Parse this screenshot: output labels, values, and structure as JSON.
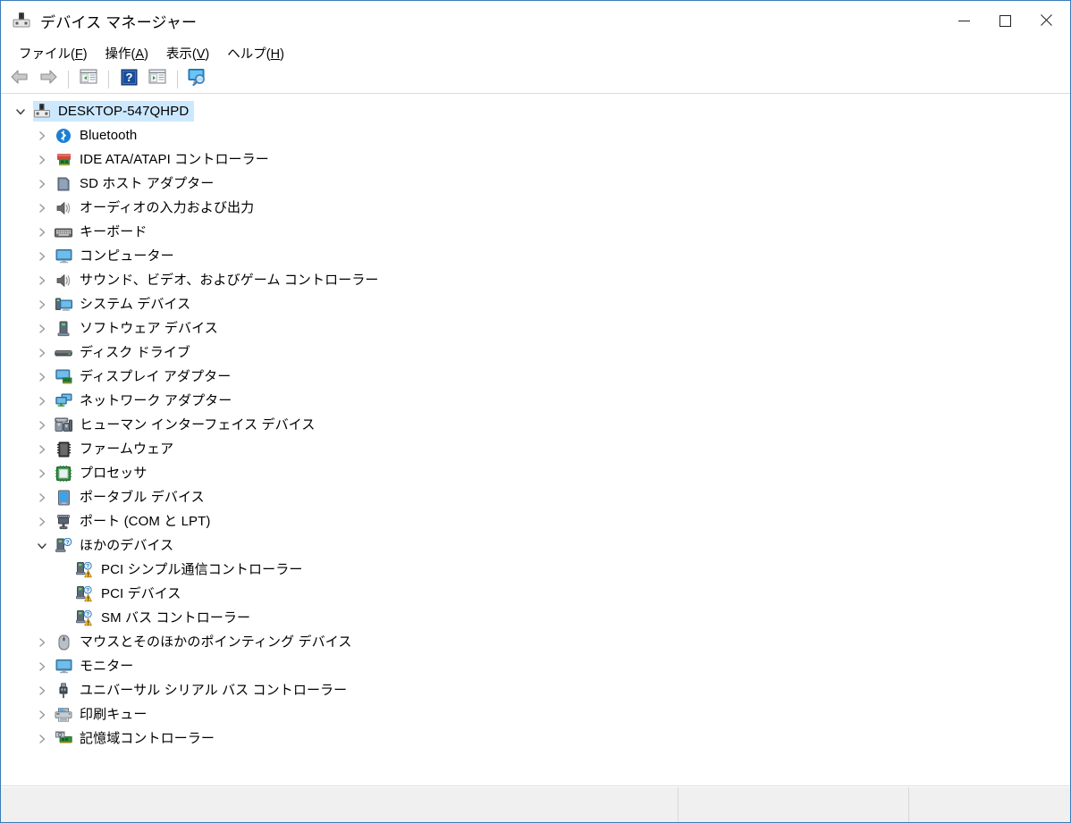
{
  "window": {
    "title": "デバイス マネージャー",
    "icon": "device-manager-icon",
    "controls": {
      "minimize": "最小化",
      "maximize": "最大化",
      "close": "閉じる"
    }
  },
  "menubar": {
    "items": [
      {
        "label": "ファイル(F)",
        "text": "ファイル(",
        "accel": "F",
        "tail": ")"
      },
      {
        "label": "操作(A)",
        "text": "操作(",
        "accel": "A",
        "tail": ")"
      },
      {
        "label": "表示(V)",
        "text": "表示(",
        "accel": "V",
        "tail": ")"
      },
      {
        "label": "ヘルプ(H)",
        "text": "ヘルプ(",
        "accel": "H",
        "tail": ")"
      }
    ]
  },
  "toolbar": {
    "buttons": [
      {
        "name": "back-button",
        "icon": "arrow-left-icon"
      },
      {
        "name": "forward-button",
        "icon": "arrow-right-icon"
      },
      {
        "name": "show-hide-console-tree-button",
        "icon": "console-tree-icon"
      },
      {
        "name": "help-button",
        "icon": "question-mark-icon"
      },
      {
        "name": "properties-button",
        "icon": "properties-icon"
      },
      {
        "name": "scan-for-hardware-changes-button",
        "icon": "scan-hardware-icon"
      }
    ]
  },
  "tree": {
    "nodes": [
      {
        "label": "DESKTOP-547QHPD",
        "level": 0,
        "state": "expanded",
        "icon": "computer-root-icon",
        "selected": true
      },
      {
        "label": "Bluetooth",
        "level": 1,
        "state": "collapsed",
        "icon": "bluetooth-icon",
        "selected": false
      },
      {
        "label": "IDE ATA/ATAPI コントローラー",
        "level": 1,
        "state": "collapsed",
        "icon": "ide-controller-icon",
        "selected": false
      },
      {
        "label": "SD ホスト アダプター",
        "level": 1,
        "state": "collapsed",
        "icon": "sd-host-adapter-icon",
        "selected": false
      },
      {
        "label": "オーディオの入力および出力",
        "level": 1,
        "state": "collapsed",
        "icon": "speaker-icon",
        "selected": false
      },
      {
        "label": "キーボード",
        "level": 1,
        "state": "collapsed",
        "icon": "keyboard-icon",
        "selected": false
      },
      {
        "label": "コンピューター",
        "level": 1,
        "state": "collapsed",
        "icon": "monitor-icon",
        "selected": false
      },
      {
        "label": "サウンド、ビデオ、およびゲーム コントローラー",
        "level": 1,
        "state": "collapsed",
        "icon": "speaker-icon",
        "selected": false
      },
      {
        "label": "システム デバイス",
        "level": 1,
        "state": "collapsed",
        "icon": "system-devices-icon",
        "selected": false
      },
      {
        "label": "ソフトウェア デバイス",
        "level": 1,
        "state": "collapsed",
        "icon": "software-device-icon",
        "selected": false
      },
      {
        "label": "ディスク ドライブ",
        "level": 1,
        "state": "collapsed",
        "icon": "disk-drive-icon",
        "selected": false
      },
      {
        "label": "ディスプレイ アダプター",
        "level": 1,
        "state": "collapsed",
        "icon": "display-adapter-icon",
        "selected": false
      },
      {
        "label": "ネットワーク アダプター",
        "level": 1,
        "state": "collapsed",
        "icon": "network-adapter-icon",
        "selected": false
      },
      {
        "label": "ヒューマン インターフェイス デバイス",
        "level": 1,
        "state": "collapsed",
        "icon": "hid-icon",
        "selected": false
      },
      {
        "label": "ファームウェア",
        "level": 1,
        "state": "collapsed",
        "icon": "firmware-icon",
        "selected": false
      },
      {
        "label": "プロセッサ",
        "level": 1,
        "state": "collapsed",
        "icon": "processor-icon",
        "selected": false
      },
      {
        "label": "ポータブル デバイス",
        "level": 1,
        "state": "collapsed",
        "icon": "portable-device-icon",
        "selected": false
      },
      {
        "label": "ポート (COM と LPT)",
        "level": 1,
        "state": "collapsed",
        "icon": "port-icon",
        "selected": false
      },
      {
        "label": "ほかのデバイス",
        "level": 1,
        "state": "expanded",
        "icon": "unknown-device-icon",
        "selected": false
      },
      {
        "label": "PCI シンプル通信コントローラー",
        "level": 2,
        "state": "leaf",
        "icon": "unknown-device-warning-icon",
        "selected": false
      },
      {
        "label": "PCI デバイス",
        "level": 2,
        "state": "leaf",
        "icon": "unknown-device-warning-icon",
        "selected": false
      },
      {
        "label": "SM バス コントローラー",
        "level": 2,
        "state": "leaf",
        "icon": "unknown-device-warning-icon",
        "selected": false
      },
      {
        "label": "マウスとそのほかのポインティング デバイス",
        "level": 1,
        "state": "collapsed",
        "icon": "mouse-icon",
        "selected": false
      },
      {
        "label": "モニター",
        "level": 1,
        "state": "collapsed",
        "icon": "monitor-icon",
        "selected": false
      },
      {
        "label": "ユニバーサル シリアル バス コントローラー",
        "level": 1,
        "state": "collapsed",
        "icon": "usb-icon",
        "selected": false
      },
      {
        "label": "印刷キュー",
        "level": 1,
        "state": "collapsed",
        "icon": "printer-icon",
        "selected": false
      },
      {
        "label": "記憶域コントローラー",
        "level": 1,
        "state": "collapsed",
        "icon": "storage-controller-icon",
        "selected": false
      }
    ]
  },
  "statusbar": {
    "panes": [
      "",
      "",
      ""
    ]
  },
  "colors": {
    "window_border": "#3a7cb8",
    "selection": "#cce8ff",
    "statusbar_bg": "#f0f0f0",
    "text": "#000000",
    "bluetooth_blue": "#1b7fd4",
    "warning_yellow": "#f5c243"
  }
}
